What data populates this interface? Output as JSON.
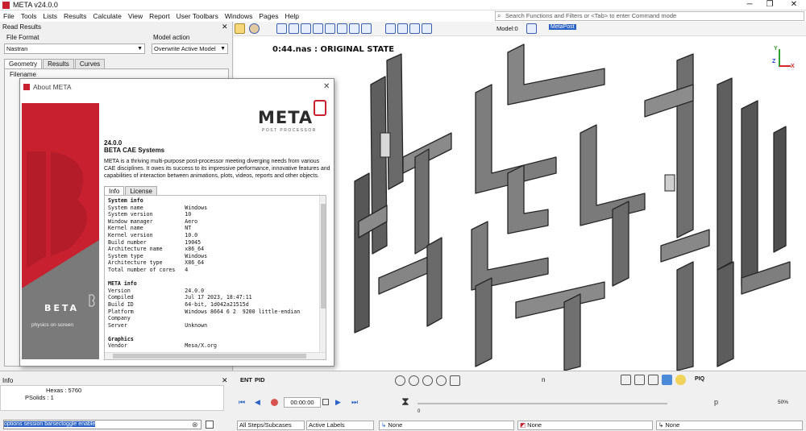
{
  "window": {
    "title": "META v24.0.0",
    "minimize_glyph": "─",
    "maximize_glyph": "❐",
    "close_glyph": "✕"
  },
  "menu": [
    "File",
    "Tools",
    "Lists",
    "Results",
    "Calculate",
    "View",
    "Report",
    "User Toolbars",
    "Windows",
    "Pages",
    "Help"
  ],
  "search": {
    "placeholder": "Search Functions and Filters or <Tab> to enter Command mode"
  },
  "toolbar": {
    "model_label": "Model:0",
    "metapost_label": "MetaPost"
  },
  "read_results": {
    "title": "Read Results",
    "file_format_label": "File Format",
    "file_format_value": "Nastran",
    "model_action_label": "Model action",
    "model_action_value": "Overwrite Active Model",
    "tabs": [
      "Geometry",
      "Results",
      "Curves"
    ],
    "filename_label": "Filename"
  },
  "viewport": {
    "title": "0:44.nas  : ORIGINAL STATE",
    "axis_x": "X",
    "axis_y": "Y",
    "axis_z": "Z"
  },
  "about": {
    "title": "About META",
    "logo": "META",
    "logo_sub": "POST PROCESSOR",
    "brand_name": "BETA",
    "brand_tagline": "physics on screen",
    "version": "24.0.0",
    "company": "BETA CAE Systems",
    "description": "META is a thriving multi-purpose post-processor meeting diverging needs from various CAE disciplines. It owes its success to its impressive performance, innovative features and capabilities of interaction between animations, plots, videos, reports and other objects.",
    "tabs": [
      "Info",
      "License"
    ],
    "info_lines": [
      "System info",
      "System name             Windows",
      "System version          10",
      "Window manager          Aero",
      "Kernel name             NT",
      "Kernel version          10.0",
      "Build number            19045",
      "Architecture name       x86_64",
      "System type             Windows",
      "Architecture type       X86_64",
      "Total number of cores   4",
      "",
      "META info",
      "Version                 24.0.0",
      "Compiled                Jul 17 2023, 18:47:11",
      "Build ID                64-bit, 1d042a21515d",
      "Platform                Windows 8664 6 2  9200 little-endian",
      "Company",
      "Server                  Unknown",
      "",
      "Graphics",
      "Vendor                  Mesa/X.org"
    ]
  },
  "info_panel": {
    "title": "Info",
    "lines": [
      "Hexas : 5760",
      "PSolids : 1"
    ]
  },
  "command": {
    "text": "options session barsectoggle enable"
  },
  "playback": {
    "time": "00:00:00",
    "frame_start": "0"
  },
  "toolbar2": {
    "ent_label": "ENT",
    "pid_label": "PID",
    "n_label": "n",
    "piq_label": "PIQ",
    "pct_label": "50%",
    "p_label": "p"
  },
  "status": {
    "steps": "All Steps/Subcases",
    "labels": "Active Labels",
    "none1": "None",
    "none2": "None",
    "none3": "None"
  },
  "colors": {
    "brand_red": "#c8202f",
    "mesh_grey": "#6e6e6e",
    "accent_blue": "#2a62c6"
  }
}
